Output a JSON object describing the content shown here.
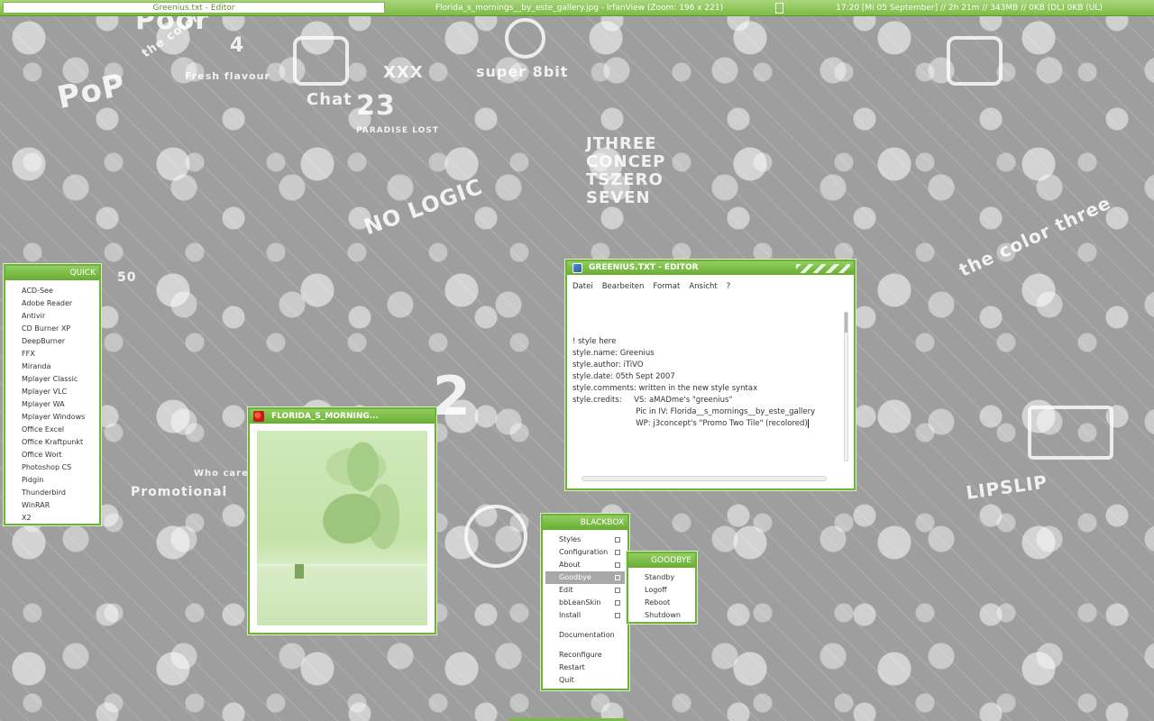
{
  "toolbar": {
    "active_task": "Greenius.txt - Editor",
    "window_title": "Florida_s_mornings__by_este_gallery.jpg - IrfanView (Zoom: 196 x 221)",
    "clock": "17:20  [Mi 05 September] // 2h 21m // 343MB // 0KB (DL)  0KB (UL)"
  },
  "quick_menu": {
    "title": "QUICK",
    "items": [
      "ACD-See",
      "Adobe Reader",
      "Antivir",
      "CD Burner XP",
      "DeepBurner",
      "FFX",
      "Miranda",
      "Mplayer Classic",
      "Mplayer VLC",
      "Mplayer WA",
      "Mplayer Windows",
      "Office Excel",
      "Office Kraftpunkt",
      "Office Wort",
      "Photoshop CS",
      "Pidgin",
      "Thunderbird",
      "WinRAR",
      "X2"
    ]
  },
  "image_window": {
    "title": "FLORIDA_S_MORNING..."
  },
  "editor": {
    "title": "GREENIUS.TXT - EDITOR",
    "menu": [
      "Datei",
      "Bearbeiten",
      "Format",
      "Ansicht",
      "?"
    ],
    "lines": [
      "! style here",
      "style.name: Greenius",
      "style.author: iTiVO",
      "style.date: 05th Sept 2007",
      "style.comments: written in the new style syntax",
      "style.credits:     VS: aMADme's \"greenius\"",
      "                          Pic in IV: Florida__s_mornings__by_este_gallery",
      "                          WP: j3concept's \"Promo Two Tile\" (recolored)"
    ]
  },
  "blackbox_menu": {
    "title": "BLACKBOX",
    "items": [
      {
        "label": "Styles",
        "sub": true
      },
      {
        "label": "Configuration",
        "sub": true
      },
      {
        "label": "About",
        "sub": true
      },
      {
        "label": "Goodbye",
        "sub": true,
        "active": true
      },
      {
        "label": "Edit",
        "sub": true
      },
      {
        "label": "bbLeanSkin",
        "sub": true
      },
      {
        "label": "Install",
        "sub": true
      },
      {
        "label": "Documentation",
        "sub": false,
        "gap": true
      },
      {
        "label": "Reconfigure",
        "sub": false,
        "gap": true
      },
      {
        "label": "Restart",
        "sub": false
      },
      {
        "label": "Quit",
        "sub": false
      }
    ]
  },
  "goodbye_menu": {
    "title": "GOODBYE",
    "items": [
      "Standby",
      "Logoff",
      "Reboot",
      "Shutdown"
    ]
  },
  "wallpaper_text": [
    "PoP",
    "Poor",
    "the color three",
    "Chat",
    "23",
    "PARADISE LOST",
    "XXX",
    "super 8bit",
    "JTHREE CONCEP TSZERO SEVEN",
    "50",
    "NO LOGIC",
    "the color three",
    "Promotional",
    "LIPSLIP",
    "Who cares",
    "Fresh flavour",
    "4",
    "2"
  ],
  "colors": {
    "accent": "#6fb23b",
    "accent_light": "#a9d67c",
    "wallpaper": "#9e9e9e"
  }
}
